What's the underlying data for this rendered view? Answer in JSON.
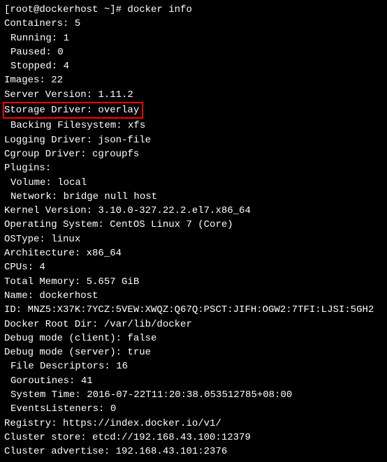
{
  "terminal": {
    "prompt": "[root@dockerhost ~]# docker info",
    "lines": {
      "containers": "Containers: 5",
      "running": "Running: 1",
      "paused": "Paused: 0",
      "stopped": "Stopped: 4",
      "images": "Images: 22",
      "server_version": "Server Version: 1.11.2",
      "storage_driver": "Storage Driver: overlay",
      "backing_fs": "Backing Filesystem: xfs",
      "logging_driver": "Logging Driver: json-file",
      "cgroup_driver": "Cgroup Driver: cgroupfs",
      "plugins": "Plugins:",
      "volume": "Volume: local",
      "network": "Network: bridge null host",
      "kernel": "Kernel Version: 3.10.0-327.22.2.el7.x86_64",
      "os": "Operating System: CentOS Linux 7 (Core)",
      "ostype": "OSType: linux",
      "arch": "Architecture: x86_64",
      "cpus": "CPUs: 4",
      "memory": "Total Memory: 5.657 GiB",
      "name": "Name: dockerhost",
      "id": "ID: MNZ5:X37K:7YCZ:5VEW:XWQZ:Q67Q:PSCT:JIFH:OGW2:7TFI:LJSI:5GH2",
      "root_dir": "Docker Root Dir: /var/lib/docker",
      "debug_client": "Debug mode (client): false",
      "debug_server": "Debug mode (server): true",
      "file_desc": "File Descriptors: 16",
      "goroutines": "Goroutines: 41",
      "system_time": "System Time: 2016-07-22T11:20:38.053512785+08:00",
      "events": "EventsListeners: 0",
      "registry": "Registry: https://index.docker.io/v1/",
      "cluster_store": "Cluster store: etcd://192.168.43.100:12379",
      "cluster_advertise": "Cluster advertise: 192.168.43.101:2376"
    }
  }
}
